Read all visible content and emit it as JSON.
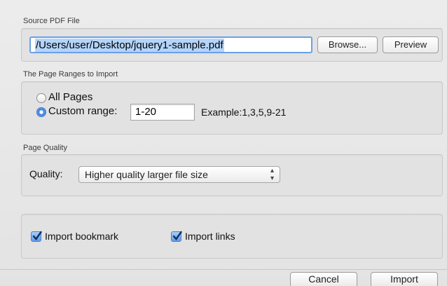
{
  "source_section": {
    "title": "Source PDF File",
    "path_value": "/Users/user/Desktop/jquery1-sample.pdf",
    "browse_label": "Browse...",
    "preview_label": "Preview"
  },
  "range_section": {
    "title": "The Page Ranges to Import",
    "all_pages_label": "All Pages",
    "custom_range_label": "Custom range:",
    "custom_range_value": "1-20",
    "example_text": "Example:1,3,5,9-21",
    "selected": "custom"
  },
  "quality_section": {
    "title": "Page Quality",
    "quality_label": "Quality:",
    "quality_value": "Higher quality larger file size"
  },
  "options_section": {
    "import_bookmark_label": "Import bookmark",
    "import_bookmark_checked": true,
    "import_links_label": "Import links",
    "import_links_checked": true
  },
  "footer": {
    "cancel_label": "Cancel",
    "import_label": "Import"
  },
  "colors": {
    "focus_ring": "#6aa0e6",
    "selection": "#b4d4fb",
    "check_fill": "#5f9be8"
  }
}
